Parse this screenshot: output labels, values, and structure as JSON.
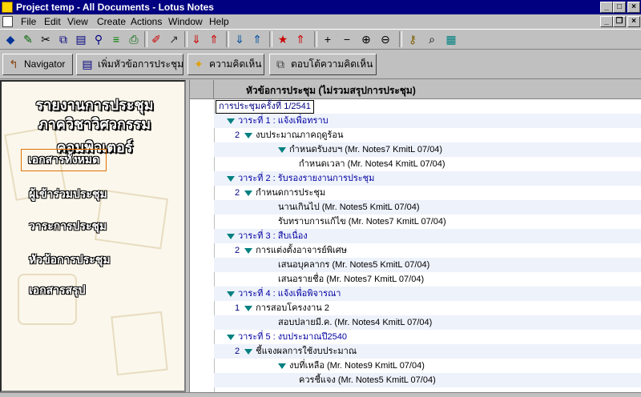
{
  "window": {
    "title": "Project temp - All Documents - Lotus Notes"
  },
  "menu": {
    "items": [
      "File",
      "Edit",
      "View",
      "Create",
      "Actions",
      "Window",
      "Help"
    ]
  },
  "toolbar": {
    "icons": [
      "open-database-icon",
      "edit-document-icon",
      "cut-icon",
      "copy-icon",
      "paste-icon",
      "properties-icon",
      "bookmark-icon",
      "print-icon",
      "send-mail-icon",
      "forward-icon",
      "move-up-icon",
      "move-top-icon",
      "next-unread-icon",
      "previous-unread-icon",
      "mark-read-icon",
      "next-marked-icon",
      "expand-icon",
      "collapse-icon",
      "expand-all-icon",
      "collapse-all-icon",
      "search-icon",
      "find-icon",
      "view-icon"
    ]
  },
  "actions": {
    "navigator": "Navigator",
    "add_topic": "เพิ่มหัวข้อการประชุม",
    "comment": "ความคิดเห็น",
    "reply": "ตอบโต้ความคิดเห็น"
  },
  "nav": {
    "title_line1": "รายงานการประชุม",
    "title_line2": "ภาควิชาวิศวกรรมคอมพิวเตอร์",
    "links": [
      "เอกสารทั้งหมด",
      "ผู้เข้าร่วมประชุม",
      "วาระการประชุม",
      "หัวข้อการประชุม",
      "เอกสารสรุป"
    ]
  },
  "view": {
    "column_header": "หัวข้อการประชุม  (ไม่รวมสรุปการประชุม)",
    "rows": [
      {
        "text": "การประชุมครั้งที่ 1/2541",
        "type": "selected"
      },
      {
        "text": "วาระที่ 1 : แจ้งเพื่อทราบ",
        "type": "cat"
      },
      {
        "count": "2",
        "text": "งบประมาณภาคฤดูร้อน",
        "type": "sub"
      },
      {
        "text": "กำหนดรับงบฯ  (Mr. Notes7 KmitL 07/04)",
        "type": "sub2"
      },
      {
        "text": "กำหนดเวลา  (Mr. Notes4 KmitL 07/04)",
        "type": "doc"
      },
      {
        "text": "วาระที่ 2 : รับรองรายงานการประชุม",
        "type": "cat"
      },
      {
        "count": "2",
        "text": "กำหนดการประชุม",
        "type": "sub"
      },
      {
        "text": "นานเกินไป  (Mr. Notes5 KmitL 07/04)",
        "type": "doc1"
      },
      {
        "text": "รับทราบการแก้ไข  (Mr. Notes7 KmitL 07/04)",
        "type": "doc1"
      },
      {
        "text": "วาระที่ 3 : สืบเนื่อง",
        "type": "cat"
      },
      {
        "count": "2",
        "text": "การแต่งตั้งอาจารย์พิเศษ",
        "type": "sub"
      },
      {
        "text": "เสนอบุคลากร  (Mr. Notes5 KmitL 07/04)",
        "type": "doc1"
      },
      {
        "text": "เสนอรายชื่อ  (Mr. Notes7 KmitL 07/04)",
        "type": "doc1"
      },
      {
        "text": "วาระที่ 4 : แจ้งเพื่อพิจารณา",
        "type": "cat"
      },
      {
        "count": "1",
        "text": "การสอบโครงงาน 2",
        "type": "sub"
      },
      {
        "text": "สอบปลายมี.ค.  (Mr. Notes4 KmitL 07/04)",
        "type": "doc1"
      },
      {
        "text": "วาระที่ 5 : งบประมาณปี2540",
        "type": "cat"
      },
      {
        "count": "2",
        "text": "ชี้แจงผลการใช้งบประมาณ",
        "type": "sub"
      },
      {
        "text": "งบที่เหลือ  (Mr. Notes9 KmitL 07/04)",
        "type": "sub2"
      },
      {
        "text": "ควรชี้แจง  (Mr. Notes5 KmitL 07/04)",
        "type": "doc"
      }
    ]
  }
}
